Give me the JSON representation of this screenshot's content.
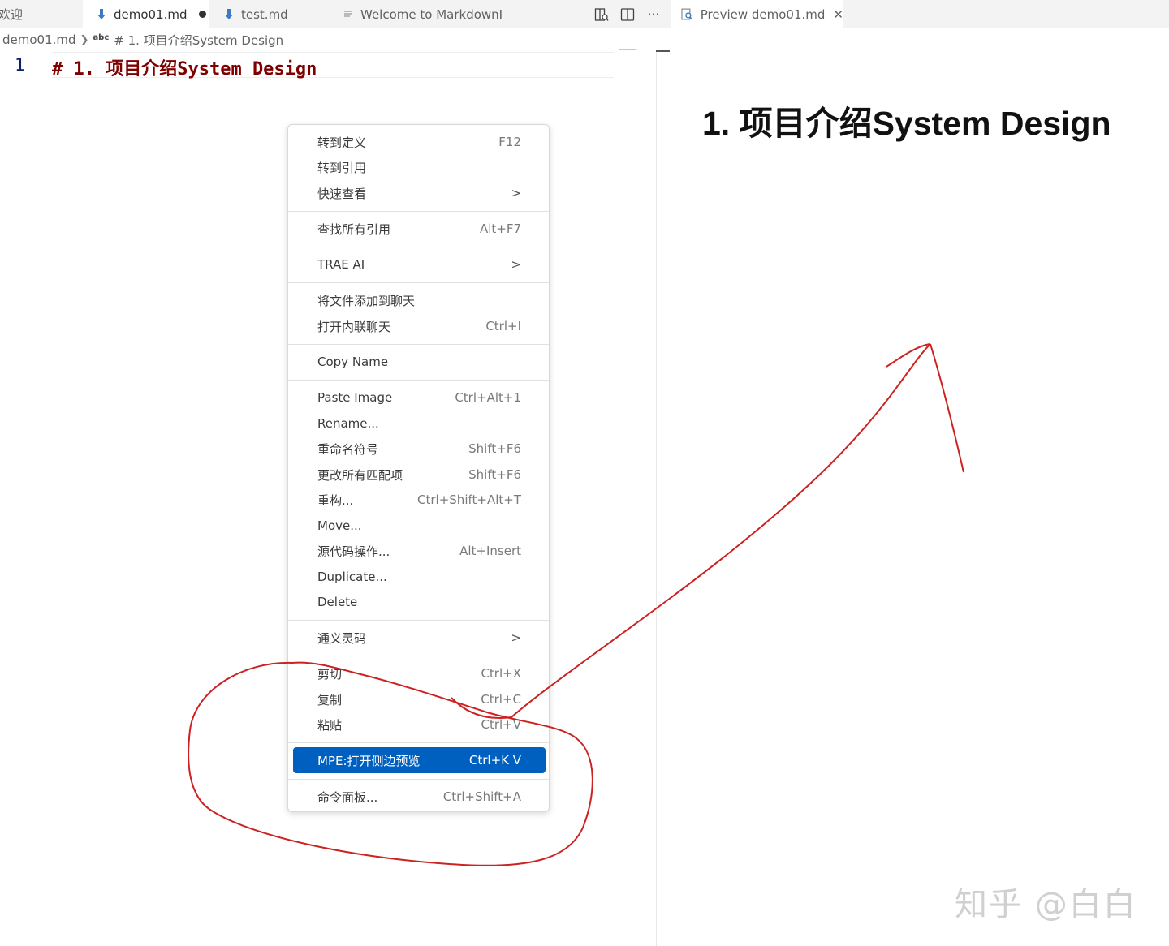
{
  "editor": {
    "tabs": [
      {
        "label": "欢迎"
      },
      {
        "label": "demo01.md"
      },
      {
        "label": "test.md"
      },
      {
        "label": "Welcome to MarkdownI"
      }
    ],
    "breadcrumb": {
      "file": "demo01.md",
      "symbol_badge": "abc",
      "symbol": "# 1. 项目介绍System Design"
    },
    "line_number": "1",
    "code": "# 1. 项目介绍System Design"
  },
  "preview": {
    "tab_label": "Preview demo01.md",
    "heading": "1. 项目介绍System Design"
  },
  "context_menu": {
    "items": [
      {
        "label": "转到定义",
        "shortcut": "F12"
      },
      {
        "label": "转到引用",
        "shortcut": ""
      },
      {
        "label": "快速查看",
        "shortcut": ""
      },
      {
        "label": "查找所有引用",
        "shortcut": "Alt+F7"
      },
      {
        "label": "TRAE AI",
        "shortcut": ""
      },
      {
        "label": "将文件添加到聊天",
        "shortcut": ""
      },
      {
        "label": "打开内联聊天",
        "shortcut": "Ctrl+I"
      },
      {
        "label": "Copy Name",
        "shortcut": ""
      },
      {
        "label": "Paste Image",
        "shortcut": "Ctrl+Alt+1"
      },
      {
        "label": "Rename...",
        "shortcut": ""
      },
      {
        "label": "重命名符号",
        "shortcut": "Shift+F6"
      },
      {
        "label": "更改所有匹配项",
        "shortcut": "Shift+F6"
      },
      {
        "label": "重构...",
        "shortcut": "Ctrl+Shift+Alt+T"
      },
      {
        "label": "Move...",
        "shortcut": ""
      },
      {
        "label": "源代码操作...",
        "shortcut": "Alt+Insert"
      },
      {
        "label": "Duplicate...",
        "shortcut": ""
      },
      {
        "label": "Delete",
        "shortcut": ""
      },
      {
        "label": "通义灵码",
        "shortcut": ""
      },
      {
        "label": "剪切",
        "shortcut": "Ctrl+X"
      },
      {
        "label": "复制",
        "shortcut": "Ctrl+C"
      },
      {
        "label": "粘贴",
        "shortcut": "Ctrl+V"
      },
      {
        "label": "MPE:打开侧边预览",
        "shortcut": "Ctrl+K V"
      },
      {
        "label": "命令面板...",
        "shortcut": "Ctrl+Shift+A"
      }
    ]
  },
  "watermark": "知乎 @白白",
  "colors": {
    "selection": "#0060c0",
    "heading_code": "#800000",
    "annotation": "#cc2222"
  }
}
